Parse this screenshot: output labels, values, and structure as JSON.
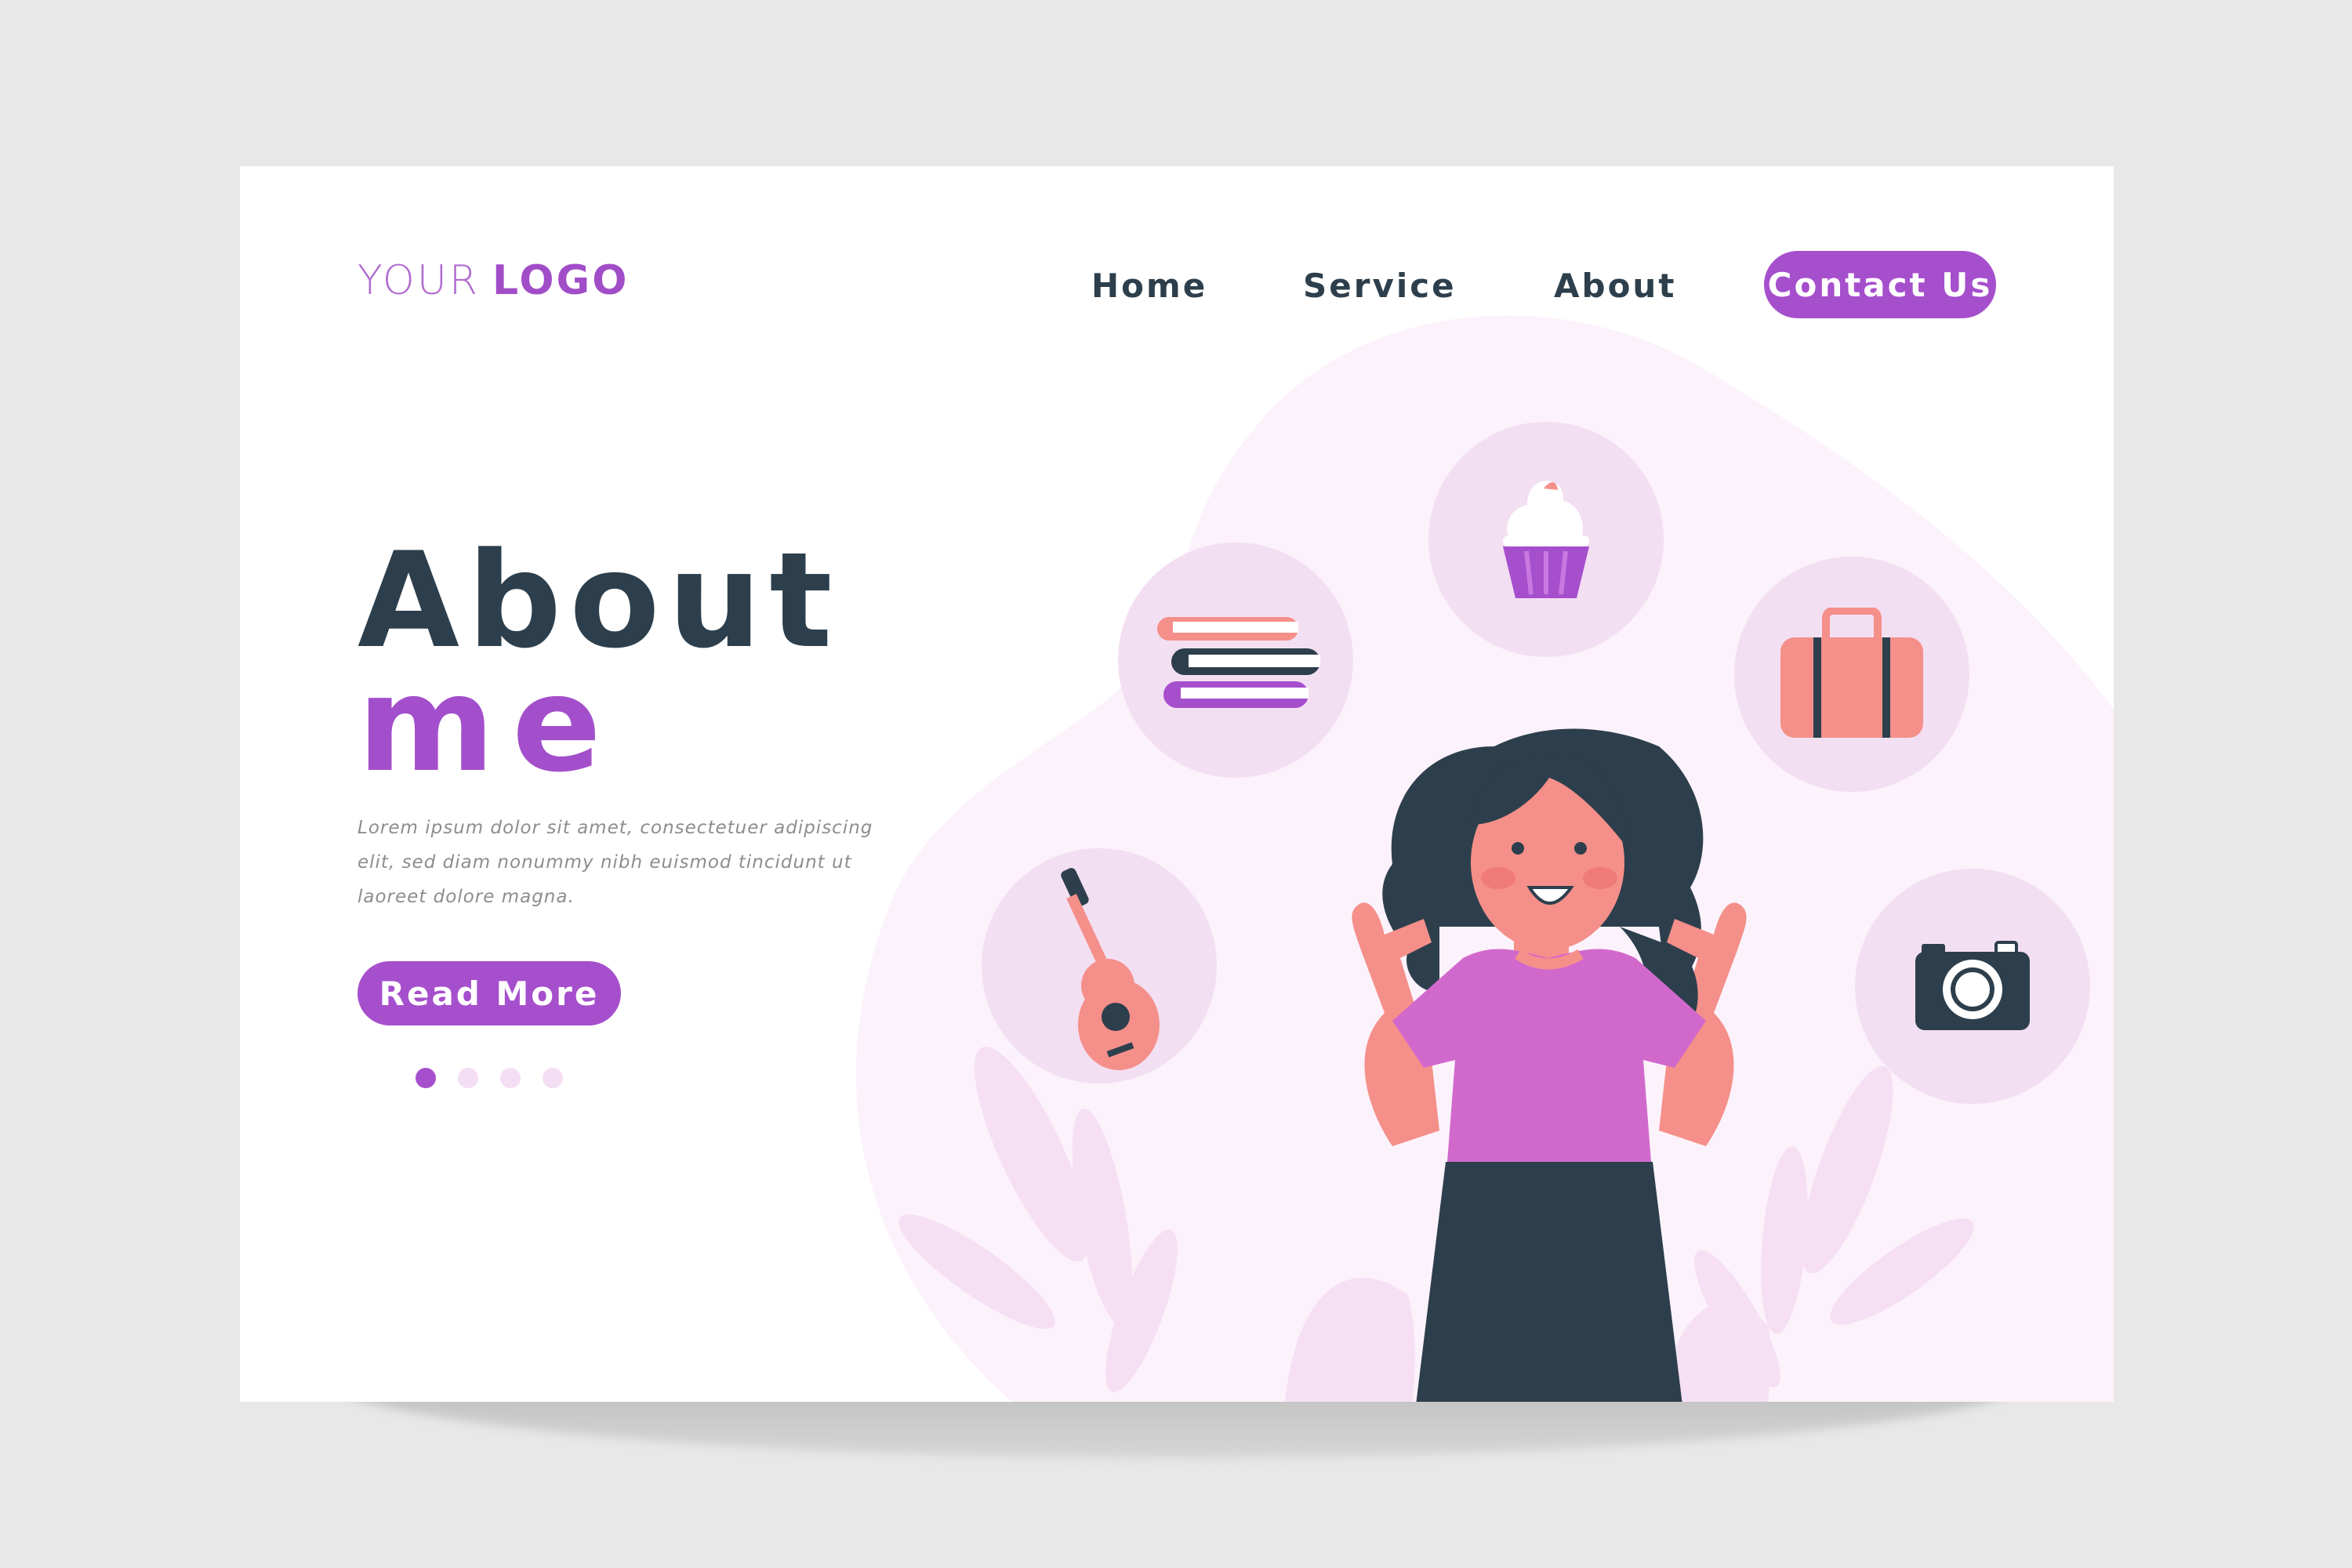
{
  "header": {
    "logo_light": "YOUR",
    "logo_bold": "LOGO",
    "nav": [
      "Home",
      "Service",
      "About"
    ],
    "contact_label": "Contact Us"
  },
  "hero": {
    "title_line1": "About",
    "title_line2": "me",
    "description": "Lorem ipsum dolor sit amet, consectetuer adipiscing elit, sed diam nonummy nibh euismod tincidunt ut laoreet dolore magna.",
    "read_more_label": "Read More"
  },
  "carousel": {
    "count": 4,
    "active_index": 0
  },
  "hobby_icons": [
    "books-icon",
    "cupcake-icon",
    "suitcase-icon",
    "guitar-icon",
    "camera-icon"
  ],
  "colors": {
    "accent": "#a64fcd",
    "heading": "#2d3f4c",
    "icon_circle": "#f3dff2",
    "blob": "#fcf2fb",
    "skin": "#f58f8a"
  }
}
